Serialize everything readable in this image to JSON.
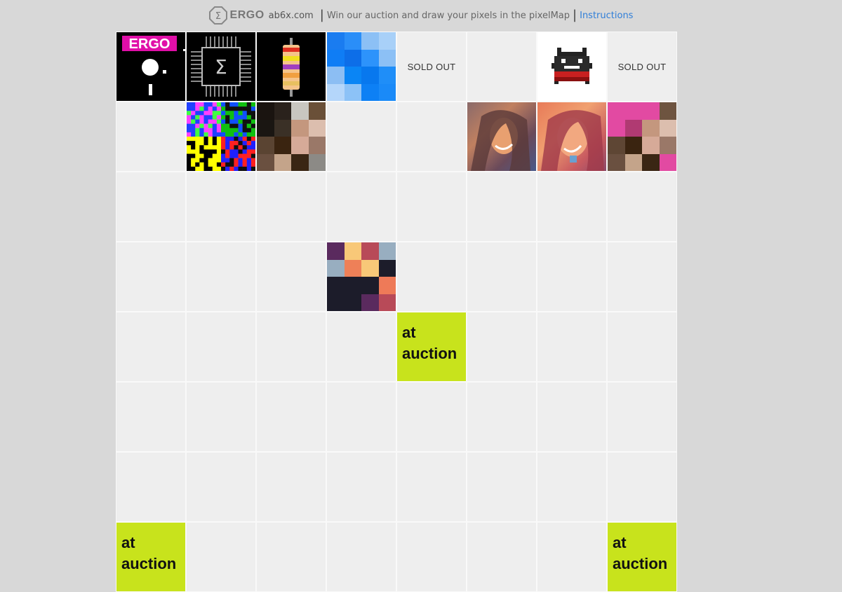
{
  "header": {
    "logo_text": "ERGO",
    "site": "ab6x.com",
    "separator": "|",
    "tagline": "Win our auction and draw your pixels in the pixelMap",
    "instructions": "Instructions"
  },
  "grid": {
    "sold_label": "SOLD OUT",
    "auction_label_line1": "at",
    "auction_label_line2": "auction"
  },
  "tiles": {
    "ergo_badge_text": "ERGO",
    "blue_checker": [
      "#1a7cf0",
      "#2a8ef8",
      "#8cc0f5",
      "#a8d0f8",
      "#0f7df5",
      "#0d6ee8",
      "#2d93fb",
      "#8cc0f5",
      "#8cbef3",
      "#0a85f5",
      "#0878ee",
      "#1f8ef8",
      "#b4d6fa",
      "#8cc2f7",
      "#0d80f5",
      "#1a8af8"
    ],
    "skin_mosaic": [
      "#1a1410",
      "#2a221c",
      "#c8c6c0",
      "#6a5038",
      "#1a1612",
      "#3a3026",
      "#c4977e",
      "#dcbeae",
      "#5a4432",
      "#3a2410",
      "#d6aa98",
      "#9a7868",
      "#6a5040",
      "#c4a48a",
      "#3a2614",
      "#8c8a86"
    ],
    "pink_mosaic": [
      "#e24aa2",
      "#e24aa2",
      "#e24aa2",
      "#6e5440",
      "#e24aa2",
      "#b03a72",
      "#c4977e",
      "#dcbeae",
      "#5e4634",
      "#3a2410",
      "#d6aa98",
      "#9a7868",
      "#6a5040",
      "#c4a48a",
      "#3a2614",
      "#e24aa2"
    ],
    "warm_mosaic": [
      "#5a2a5e",
      "#f8c878",
      "#b84a58",
      "#98aec0",
      "#98aec0",
      "#ee8058",
      "#f8c878",
      "#1c1c2a",
      "#1c1c2a",
      "#1c1c2a",
      "#1c1c2a",
      "#ee7a58",
      "#1c1c2a",
      "#1c1c2a",
      "#5a2a5e",
      "#b84a58"
    ]
  }
}
